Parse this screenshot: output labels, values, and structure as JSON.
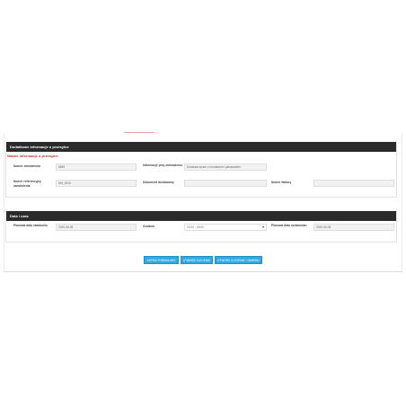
{
  "section1": {
    "header": "Dodatkowe informacje o przesyłce",
    "subtitle": "Ważne informacje o przesyłce",
    "fields": {
      "order_number": {
        "label": "Numer zamówienia",
        "value": "8589"
      },
      "order_info": {
        "label": "Informacje przy zamówieniu",
        "value": "Dostawa razem z montażem i palowaniem"
      },
      "reference_number": {
        "label": "Numer referencyjny zamówienia",
        "value": "DM_0015"
      },
      "delivery_proof": {
        "label": "Dokument dostawowy",
        "value": ""
      },
      "invoice_number": {
        "label": "Numer faktury",
        "value": ""
      }
    }
  },
  "section2": {
    "header": "Data i czas",
    "fields": {
      "pickup_date": {
        "label": "Planowa data załadunku",
        "value": "2020-06-05"
      },
      "hours": {
        "label": "Godzina",
        "value": "12:00 - 15:00"
      },
      "delivery_date": {
        "label": "Planowa data rozładunku",
        "value": "2020-06-05"
      }
    }
  },
  "buttons": {
    "save_form": "ZAPISZ FORMULARZ",
    "create_order": "UTWÓRZ ZLECENIE",
    "create_order_close": "UTWÓRZ ZLECENIE I ZAMKNIJ"
  },
  "colors": {
    "header_bg": "#2b2b2b",
    "subtitle": "#c9302c",
    "button": "#2fa9e0"
  }
}
